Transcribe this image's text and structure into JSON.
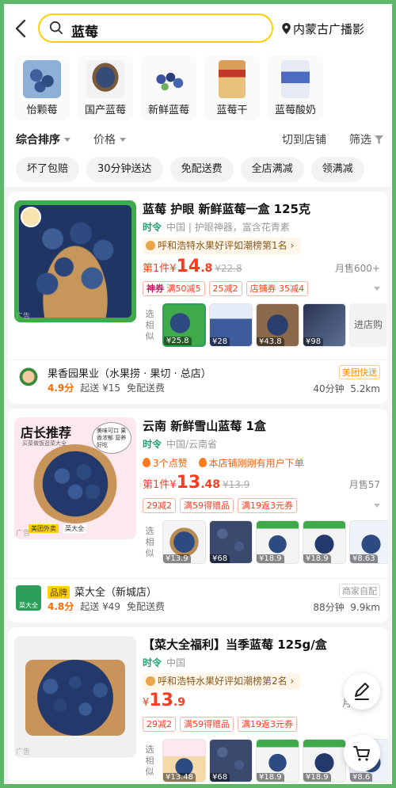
{
  "search": {
    "query": "蓝莓",
    "location": "内蒙古广播影"
  },
  "categories": [
    {
      "label": "怡颗莓"
    },
    {
      "label": "国产蓝莓"
    },
    {
      "label": "新鲜蓝莓"
    },
    {
      "label": "蓝莓干"
    },
    {
      "label": "蓝莓酸奶"
    }
  ],
  "sort": {
    "comprehensive": "综合排序",
    "price": "价格",
    "switch_store": "切到店铺",
    "filter": "筛选"
  },
  "filter_tags": [
    "坏了包赔",
    "30分钟送达",
    "免配送费",
    "全店满减",
    "领满减"
  ],
  "colors": {
    "accent": "#ffd100",
    "price": "#ff3b1f",
    "fresh_green": "#1aa36a",
    "frame": "#5fb86a"
  },
  "products": [
    {
      "title": "蓝莓 护眼 新鲜蓝莓一盒 125克",
      "season": "时令",
      "origin": "中国 | 护眼神器，富含花青素",
      "rank": "呼和浩特水果好评如潮榜第1名",
      "price_prefix": "第1件",
      "price_symbol": "¥",
      "price_int": "14",
      "price_dec": ".8",
      "old_price": "¥22.8",
      "sold": "月售600+",
      "coupons": [
        "满50减5",
        "25减2",
        "35减4"
      ],
      "coupon_special": "神券",
      "coupon_special2": "店铺券",
      "similar_label": "选相似",
      "similar_prices": [
        "¥25.8",
        "¥28",
        "¥43.8",
        "¥98"
      ],
      "more": "进店购",
      "ad": "广告",
      "store": {
        "name": "果香园果业（水果捞 · 果切 · 总店）",
        "score": "4.9分",
        "min_delivery": "起送 ¥15",
        "delivery_fee": "免配送费",
        "tag": "美团快送",
        "time": "40分钟",
        "distance": "5.2km"
      }
    },
    {
      "title": "云南 新鲜雪山蓝莓 1盒",
      "season": "时令",
      "origin": "中国/云南省",
      "hot1": "3个点赞",
      "hot2": "本店铺刚刚有用户下单",
      "price_prefix": "第1件",
      "price_symbol": "¥",
      "price_int": "13",
      "price_dec": ".48",
      "old_price": "¥13.9",
      "sold": "月售57",
      "coupons": [
        "29减2",
        "满59得赠品",
        "满19返3元券"
      ],
      "similar_label": "选相似",
      "similar_prices": [
        "¥13.9",
        "¥68",
        "¥18.9",
        "¥18.9",
        "¥8.63"
      ],
      "banner": "店长推荐",
      "banner_sub": "买菜做饭逛菜大全",
      "banner_bottom1": "美团外卖",
      "banner_bottom2": "菜大全",
      "bubble": "美味可口 果香浓郁 营养好吃",
      "ad": "广告",
      "store": {
        "brand": "品牌",
        "name": "菜大全（新城店）",
        "score": "4.8分",
        "min_delivery": "起送 ¥49",
        "delivery_fee": "免配送费",
        "tag": "商家自配",
        "time": "88分钟",
        "distance": "9.9km",
        "logo_text": "菜大全"
      }
    },
    {
      "title": "【菜大全福利】当季蓝莓 125g/盒",
      "season": "时令",
      "origin": "中国",
      "rank": "呼和浩特水果好评如潮榜第2名",
      "price_symbol": "¥",
      "price_int": "13",
      "price_dec": ".9",
      "sold": "月",
      "coupons": [
        "29减2",
        "满59得赠品",
        "满19返3元券"
      ],
      "similar_label": "选相似",
      "similar_prices": [
        "¥13.48",
        "¥68",
        "¥18.9",
        "¥18.9",
        "¥8.6"
      ],
      "ad": "广告"
    }
  ],
  "fab": {
    "edit": "edit-icon",
    "cart": "cart-icon"
  }
}
